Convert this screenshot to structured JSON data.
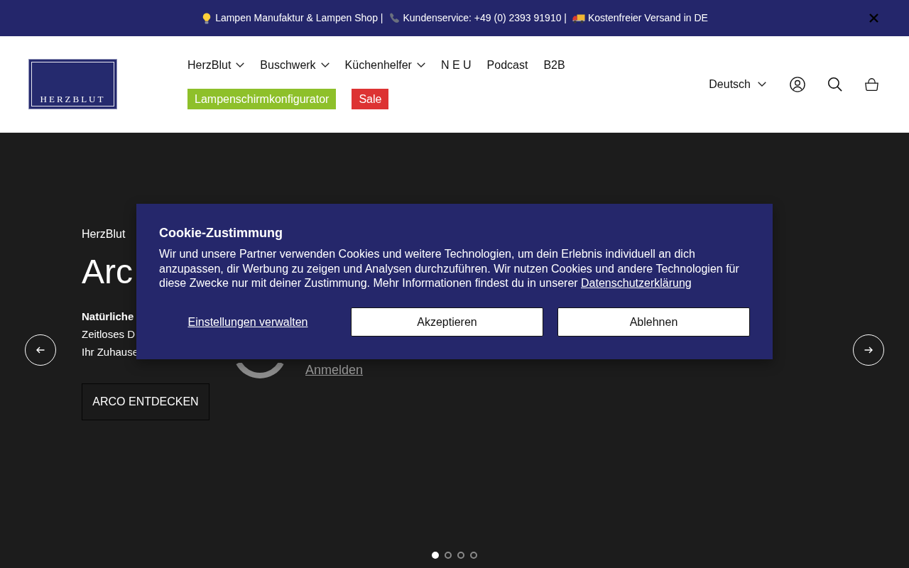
{
  "announcement": {
    "items": [
      {
        "kind": "bulb",
        "text": "Lampen Manufaktur & Lampen Shop |"
      },
      {
        "kind": "phone",
        "text": "Kundenservice: +49 (0) 2393 91910 |"
      },
      {
        "kind": "truck",
        "text": "Kostenfreier Versand in DE"
      }
    ]
  },
  "header": {
    "logo": {
      "text": "HERZBLUT"
    },
    "nav": [
      {
        "label": "HerzBlut",
        "dropdown": true
      },
      {
        "label": "Buschwerk",
        "dropdown": true
      },
      {
        "label": "Küchenhelfer",
        "dropdown": true
      },
      {
        "label": "N E U",
        "dropdown": false
      },
      {
        "label": "Podcast",
        "dropdown": false
      },
      {
        "label": "B2B",
        "dropdown": false
      }
    ],
    "nav_highlights": [
      {
        "label": "Lampenschirmkonfigurator",
        "color": "#8ec02a"
      },
      {
        "label": "Sale",
        "color": "#dd3333"
      }
    ],
    "language": {
      "label": "Deutsch"
    }
  },
  "hero": {
    "eyebrow": "HerzBlut",
    "title": "Arc",
    "lead": "Natürliche",
    "lines": [
      "Zeitloses D",
      "Ihr Zuhause"
    ],
    "cta": "ARCO ENTDECKEN",
    "behind_link": "Anmelden",
    "slides": [
      {
        "selected": true
      },
      {
        "selected": false
      },
      {
        "selected": false
      },
      {
        "selected": false
      }
    ]
  },
  "cookie_dialog": {
    "title": "Cookie-Zustimmung",
    "text": "Wir und unsere Partner verwenden Cookies und weitere Technologien, um dein Erlebnis individuell an dich anzupassen, dir Werbung zu zeigen und Analysen durchzuführen. Wir nutzen Cookies und andere Technologien für diese Zwecke nur mit deiner Zustimmung. Mehr Informationen findest du in unserer",
    "link": "Datenschutzerklärung",
    "buttons": [
      {
        "kind": "link",
        "label": "Einstellungen verwalten"
      },
      {
        "kind": "button",
        "label": "Akzeptieren"
      },
      {
        "kind": "button",
        "label": "Ablehnen"
      }
    ]
  }
}
